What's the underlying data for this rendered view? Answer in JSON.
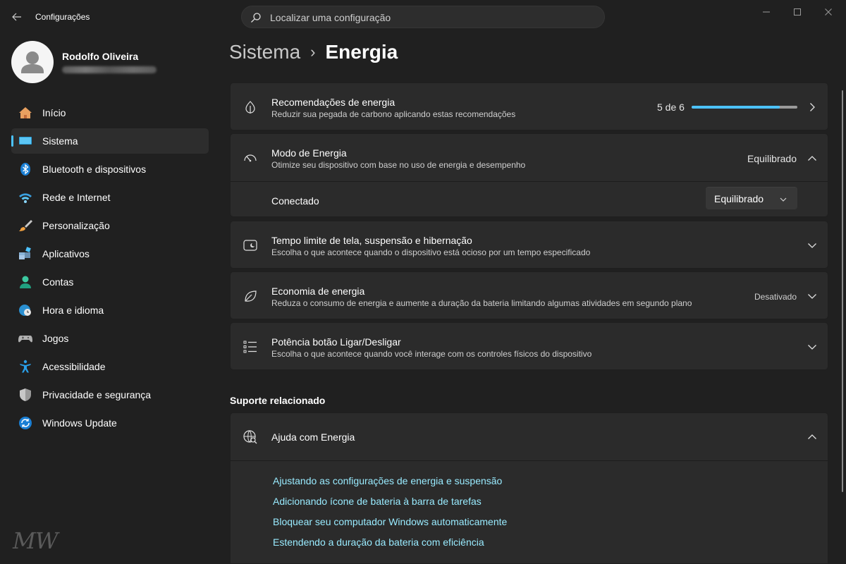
{
  "window": {
    "app_title": "Configurações",
    "search_placeholder": "Localizar uma configuração"
  },
  "profile": {
    "name": "Rodolfo Oliveira"
  },
  "sidebar": {
    "items": [
      {
        "label": "Início",
        "icon": "home-icon",
        "active": false
      },
      {
        "label": "Sistema",
        "icon": "system-icon",
        "active": true
      },
      {
        "label": "Bluetooth e dispositivos",
        "icon": "bluetooth-icon",
        "active": false
      },
      {
        "label": "Rede e Internet",
        "icon": "wifi-icon",
        "active": false
      },
      {
        "label": "Personalização",
        "icon": "brush-icon",
        "active": false
      },
      {
        "label": "Aplicativos",
        "icon": "apps-icon",
        "active": false
      },
      {
        "label": "Contas",
        "icon": "account-icon",
        "active": false
      },
      {
        "label": "Hora e idioma",
        "icon": "clock-globe-icon",
        "active": false
      },
      {
        "label": "Jogos",
        "icon": "gamepad-icon",
        "active": false
      },
      {
        "label": "Acessibilidade",
        "icon": "accessibility-icon",
        "active": false
      },
      {
        "label": "Privacidade e segurança",
        "icon": "shield-icon",
        "active": false
      },
      {
        "label": "Windows Update",
        "icon": "update-icon",
        "active": false
      }
    ]
  },
  "breadcrumb": {
    "parent": "Sistema",
    "separator": "›",
    "current": "Energia"
  },
  "cards": {
    "recommendations": {
      "title": "Recomendações de energia",
      "subtitle": "Reduzir sua pegada de carbono aplicando estas recomendações",
      "progress_text": "5 de 6",
      "progress_done": 5,
      "progress_total": 6
    },
    "power_mode": {
      "title": "Modo de Energia",
      "subtitle": "Otimize seu dispositivo com base no uso de energia e desempenho",
      "value": "Equilibrado",
      "sub_label": "Conectado",
      "dropdown_value": "Equilibrado"
    },
    "screen_timeout": {
      "title": "Tempo limite de tela, suspensão e hibernação",
      "subtitle": "Escolha o que acontece quando o dispositivo está ocioso por um tempo especificado"
    },
    "energy_saver": {
      "title": "Economia de energia",
      "subtitle": "Reduza o consumo de energia e aumente a duração da bateria limitando algumas atividades em segundo plano",
      "value": "Desativado"
    },
    "power_button": {
      "title": "Potência botão Ligar/Desligar",
      "subtitle": "Escolha o que acontece quando você interage com os controles físicos do dispositivo"
    }
  },
  "related": {
    "heading": "Suporte relacionado",
    "help_title": "Ajuda com Energia",
    "links": [
      "Ajustando as configurações de energia e suspensão",
      "Adicionando ícone de bateria à barra de tarefas",
      "Bloquear seu computador Windows automaticamente",
      "Estendendo a duração da bateria com eficiência"
    ]
  },
  "watermark": "MW",
  "colors": {
    "accent": "#4cc2ff",
    "link": "#99ebff",
    "background": "#202020",
    "card": "#2b2b2b"
  }
}
